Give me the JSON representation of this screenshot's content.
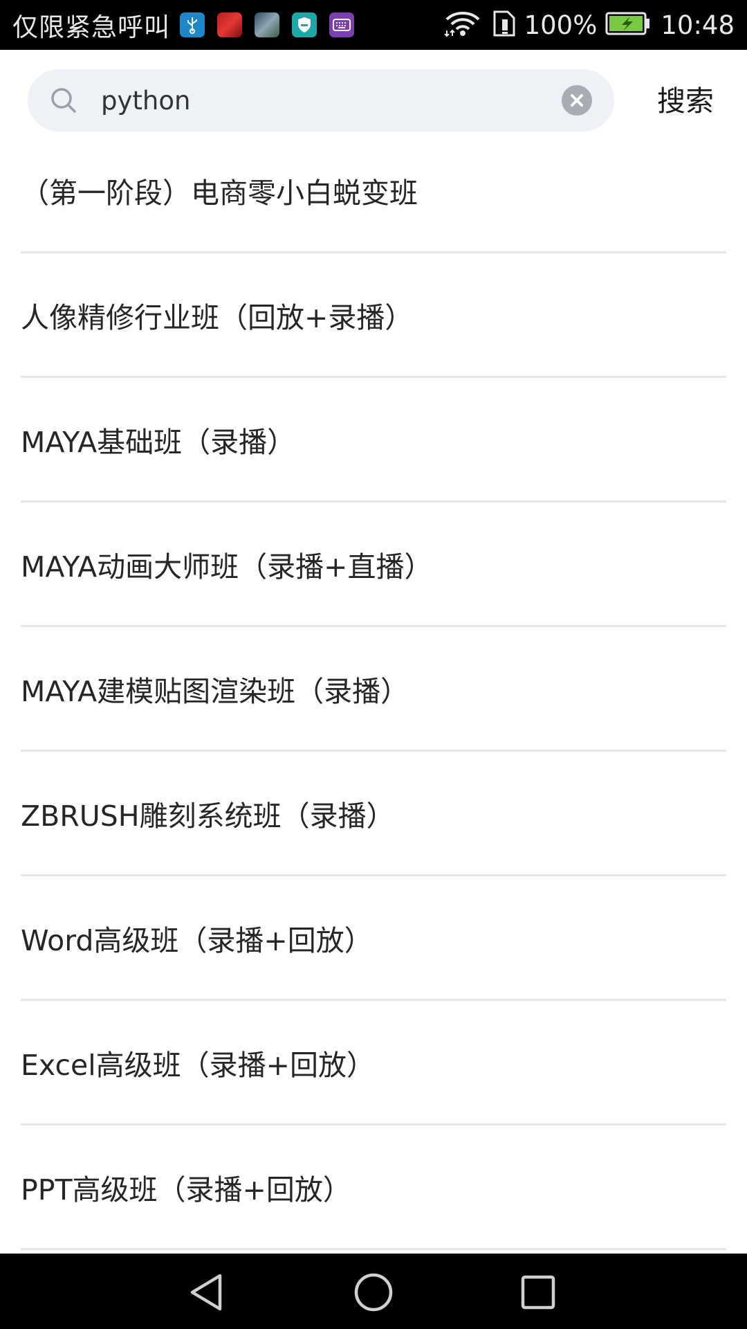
{
  "status_bar": {
    "carrier_text": "仅限紧急呼叫",
    "notification_icons": [
      "usb-icon",
      "photo-icon",
      "photo-icon",
      "shield-icon",
      "keyboard-icon"
    ],
    "battery_percent": "100%",
    "time": "10:48",
    "battery_color": "#7ac943"
  },
  "search": {
    "query": "python",
    "button_label": "搜索",
    "field_background": "#eef2f7"
  },
  "results": [
    "（第一阶段）电商零小白蜕变班",
    "人像精修行业班（回放+录播）",
    "MAYA基础班（录播）",
    "MAYA动画大师班（录播+直播）",
    "MAYA建模贴图渲染班（录播）",
    "ZBRUSH雕刻系统班（录播）",
    "Word高级班（录播+回放）",
    "Excel高级班（录播+回放）",
    "PPT高级班（录播+回放）"
  ],
  "nav_bar": {
    "icons": [
      "back-icon",
      "home-icon",
      "recent-apps-icon"
    ]
  }
}
